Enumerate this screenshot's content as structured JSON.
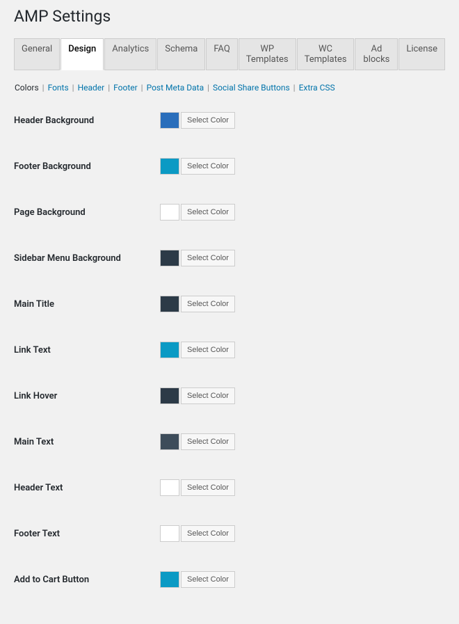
{
  "title": "AMP Settings",
  "tabs": [
    {
      "label": "General",
      "active": false
    },
    {
      "label": "Design",
      "active": true
    },
    {
      "label": "Analytics",
      "active": false
    },
    {
      "label": "Schema",
      "active": false
    },
    {
      "label": "FAQ",
      "active": false
    },
    {
      "label": "WP Templates",
      "active": false
    },
    {
      "label": "WC Templates",
      "active": false
    },
    {
      "label": "Ad blocks",
      "active": false
    },
    {
      "label": "License",
      "active": false
    }
  ],
  "subnav": [
    {
      "label": "Colors",
      "active": true
    },
    {
      "label": "Fonts",
      "active": false
    },
    {
      "label": "Header",
      "active": false
    },
    {
      "label": "Footer",
      "active": false
    },
    {
      "label": "Post Meta Data",
      "active": false
    },
    {
      "label": "Social Share Buttons",
      "active": false
    },
    {
      "label": "Extra CSS",
      "active": false
    }
  ],
  "select_color_label": "Select Color",
  "rows": [
    {
      "label": "Header Background",
      "color": "#2a6ebb"
    },
    {
      "label": "Footer Background",
      "color": "#0b9ac4"
    },
    {
      "label": "Page Background",
      "color": "#ffffff"
    },
    {
      "label": "Sidebar Menu Background",
      "color": "#2c3a47"
    },
    {
      "label": "Main Title",
      "color": "#2c3a47"
    },
    {
      "label": "Link Text",
      "color": "#0b9ac4"
    },
    {
      "label": "Link Hover",
      "color": "#2c3a47"
    },
    {
      "label": "Main Text",
      "color": "#3d4c5a"
    },
    {
      "label": "Header Text",
      "color": "#ffffff"
    },
    {
      "label": "Footer Text",
      "color": "#ffffff"
    },
    {
      "label": "Add to Cart Button",
      "color": "#0b9ac4"
    }
  ]
}
